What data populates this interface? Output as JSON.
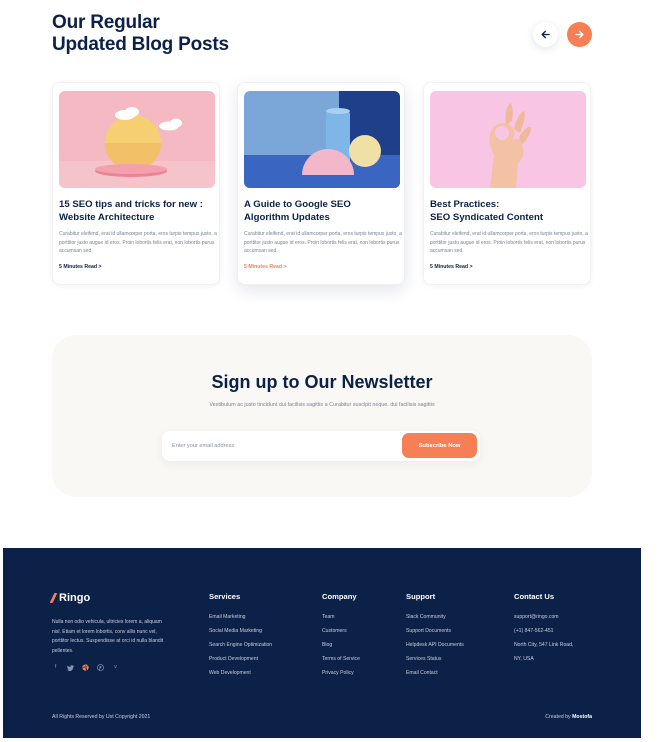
{
  "blog": {
    "title_line1": "Our Regular",
    "title_line2": "Updated Blog Posts",
    "posts": [
      {
        "title_line1": "15 SEO tips and tricks for new :",
        "title_line2": "Website Architecture",
        "excerpt": "Curabitur eleifend, erat id ullamcorper porta, eros turpis tempus justo, a porttitor justo augue id eros. Proin lobortis felis erat, non lobortis purus accumsan sed.",
        "read_more": "5 Minutes Read >"
      },
      {
        "title_line1": "A Guide to Google SEO",
        "title_line2": "Algorithm Updates",
        "excerpt": "Curabitur eleifend, erat id ullamcorper porta, eros turpis tempus justo, a porttitor justo augue id eros. Proin lobortis felis erat, non lobortis purus accumsan sed.",
        "read_more": "5 Minutes Read >"
      },
      {
        "title_line1": "Best Practices:",
        "title_line2": "SEO Syndicated Content",
        "excerpt": "Curabitur eleifend, erat id ullamcorper porta, eros turpis tempus justo, a porttitor justo augue id eros. Proin lobortis felis erat, non lobortis purus accumsan sed.",
        "read_more": "5 Minutes Read >"
      }
    ]
  },
  "newsletter": {
    "title": "Sign up to Our Newsletter",
    "subtitle": "Vestibulum ac justo tincidunt dui facilisis sagittis a Curabitur suscipit neque. dui facilisis sagittis",
    "placeholder": "Enter your email address",
    "button": "Subscribe Now"
  },
  "footer": {
    "brand": "Ringo",
    "about": "Nulla non odio vehicula, ultricies lorem a, aliquam nisl. Etiam et lorem lobortis, conv allis nunc vel, porttitor lectus. Suspendisse at orci id nulla blandit pellentes.",
    "columns": [
      {
        "title": "Services",
        "links": [
          "Email Marketing",
          "Social Media Marketing",
          "Search Engine Optimization",
          "Product Development",
          "Web Development"
        ]
      },
      {
        "title": "Company",
        "links": [
          "Team",
          "Customers",
          "Blog",
          "Terms of Service",
          "Privacy Policy"
        ]
      },
      {
        "title": "Support",
        "links": [
          "Slack Community",
          "Support Documents",
          "Helpdesk API Documents",
          "Services Status",
          "Email Contact"
        ]
      },
      {
        "title": "Contact Us",
        "links": [
          "support@ringo.com",
          "(+1) 847-562-451",
          "North City, 547 Link Road,",
          "NY, USA"
        ]
      }
    ],
    "social_icons": [
      "facebook-icon",
      "twitter-icon",
      "dribbble-icon",
      "pinterest-icon",
      "vimeo-icon"
    ],
    "copyright": "All Rights Reserved by Ust Copyright 2021",
    "credit_prefix": "Created by",
    "credit_name": "Mostofa"
  },
  "colors": {
    "navy": "#0b2148",
    "accent": "#f67f56",
    "newsletter_bg": "#faf8f5"
  }
}
